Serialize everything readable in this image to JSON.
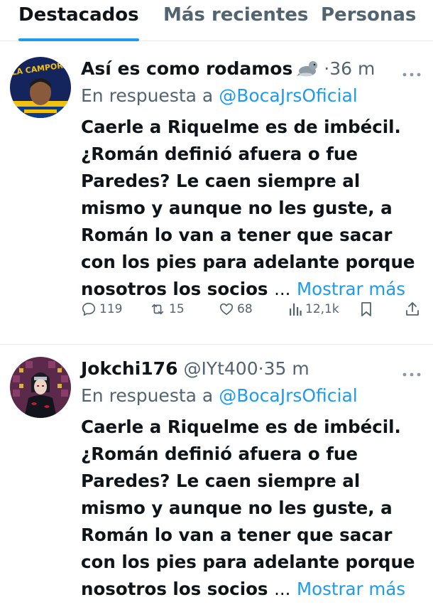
{
  "tabs": {
    "featured": "Destacados",
    "recent": "Más recientes",
    "people": "Personas"
  },
  "posts": [
    {
      "name": "Así es como rodamos",
      "handle": "",
      "dot": "·",
      "time": "36 m",
      "reply_prefix": "En respuesta a",
      "reply_to": "@BocaJrsOficial",
      "lines": [
        "Caerle a Riquelme es de imbécil.",
        "¿Román definió afuera o fue",
        "Paredes? Le caen siempre al",
        "mismo y aunque no les guste, a",
        "Román lo van a tener que sacar",
        "con los pies para adelante porque",
        "nosotros los socios"
      ],
      "ellipsis": "...",
      "show_more": "Mostrar más",
      "stats": {
        "replies": "119",
        "reposts": "15",
        "likes": "68",
        "views": "12,1k"
      },
      "avatar_text": "LA CAMPORA",
      "name_emoji": "seal-icon"
    },
    {
      "name": "Jokchi176",
      "handle": "@IYt400",
      "dot": "·",
      "time": "35 m",
      "reply_prefix": "En respuesta a",
      "reply_to": "@BocaJrsOficial",
      "lines": [
        "Caerle a Riquelme es de imbécil.",
        "¿Román definió afuera o fue",
        "Paredes? Le caen siempre al",
        "mismo y aunque no les guste, a",
        "Román lo van a tener que sacar",
        "con los pies para adelante porque",
        "nosotros los socios"
      ],
      "ellipsis": "...",
      "show_more": "Mostrar más"
    }
  ],
  "colors": {
    "accent": "#1d9bf0",
    "text": "#0f1419",
    "muted": "#536471",
    "divider": "#e6ecf0"
  }
}
